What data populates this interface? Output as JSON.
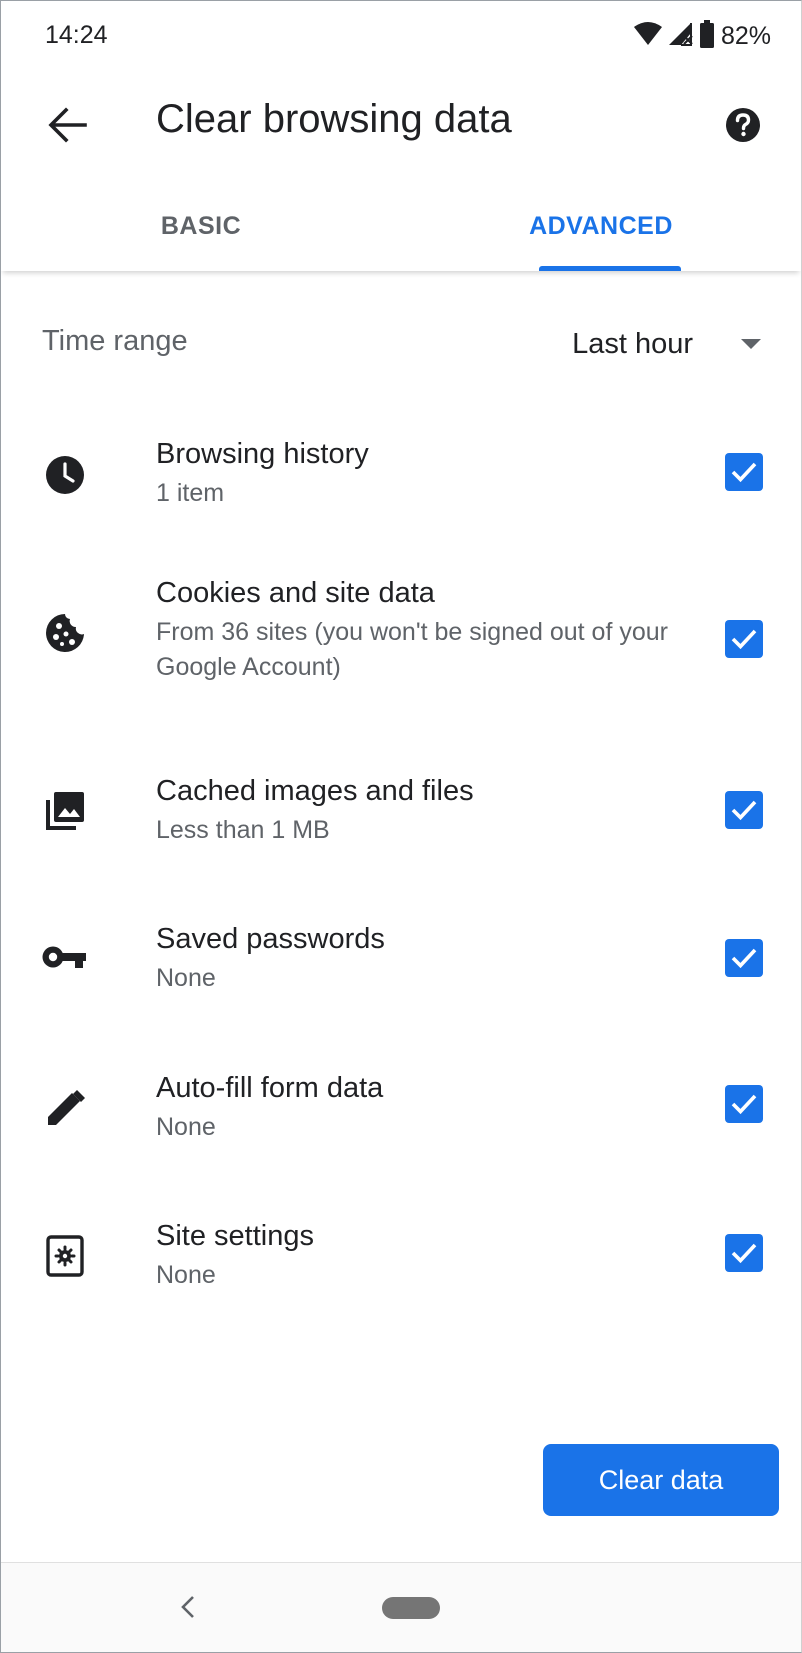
{
  "status_bar": {
    "time": "14:24",
    "battery": "82%",
    "icons": [
      "wifi-icon",
      "signal-icon",
      "battery-icon"
    ]
  },
  "app_bar": {
    "title": "Clear browsing data",
    "back_icon": "arrow-back-icon",
    "help_icon": "help-icon"
  },
  "tabs": [
    {
      "label": "BASIC",
      "selected": false
    },
    {
      "label": "ADVANCED",
      "selected": true
    }
  ],
  "time_range": {
    "label": "Time range",
    "value": "Last hour"
  },
  "options": [
    {
      "icon": "clock-icon",
      "title": "Browsing history",
      "subtitle": "1 item",
      "checked": true
    },
    {
      "icon": "cookie-icon",
      "title": "Cookies and site data",
      "subtitle": "From 36 sites (you won't be signed out of your Google Account)",
      "checked": true
    },
    {
      "icon": "images-icon",
      "title": "Cached images and files",
      "subtitle": "Less than 1 MB",
      "checked": true
    },
    {
      "icon": "key-icon",
      "title": "Saved passwords",
      "subtitle": "None",
      "checked": true
    },
    {
      "icon": "pencil-icon",
      "title": "Auto-fill form data",
      "subtitle": "None",
      "checked": true
    },
    {
      "icon": "site-settings-icon",
      "title": "Site settings",
      "subtitle": "None",
      "checked": true
    }
  ],
  "clear_button": {
    "label": "Clear data"
  },
  "colors": {
    "accent": "#1a73e8",
    "text_primary": "#202124",
    "text_secondary": "#5f6368"
  }
}
